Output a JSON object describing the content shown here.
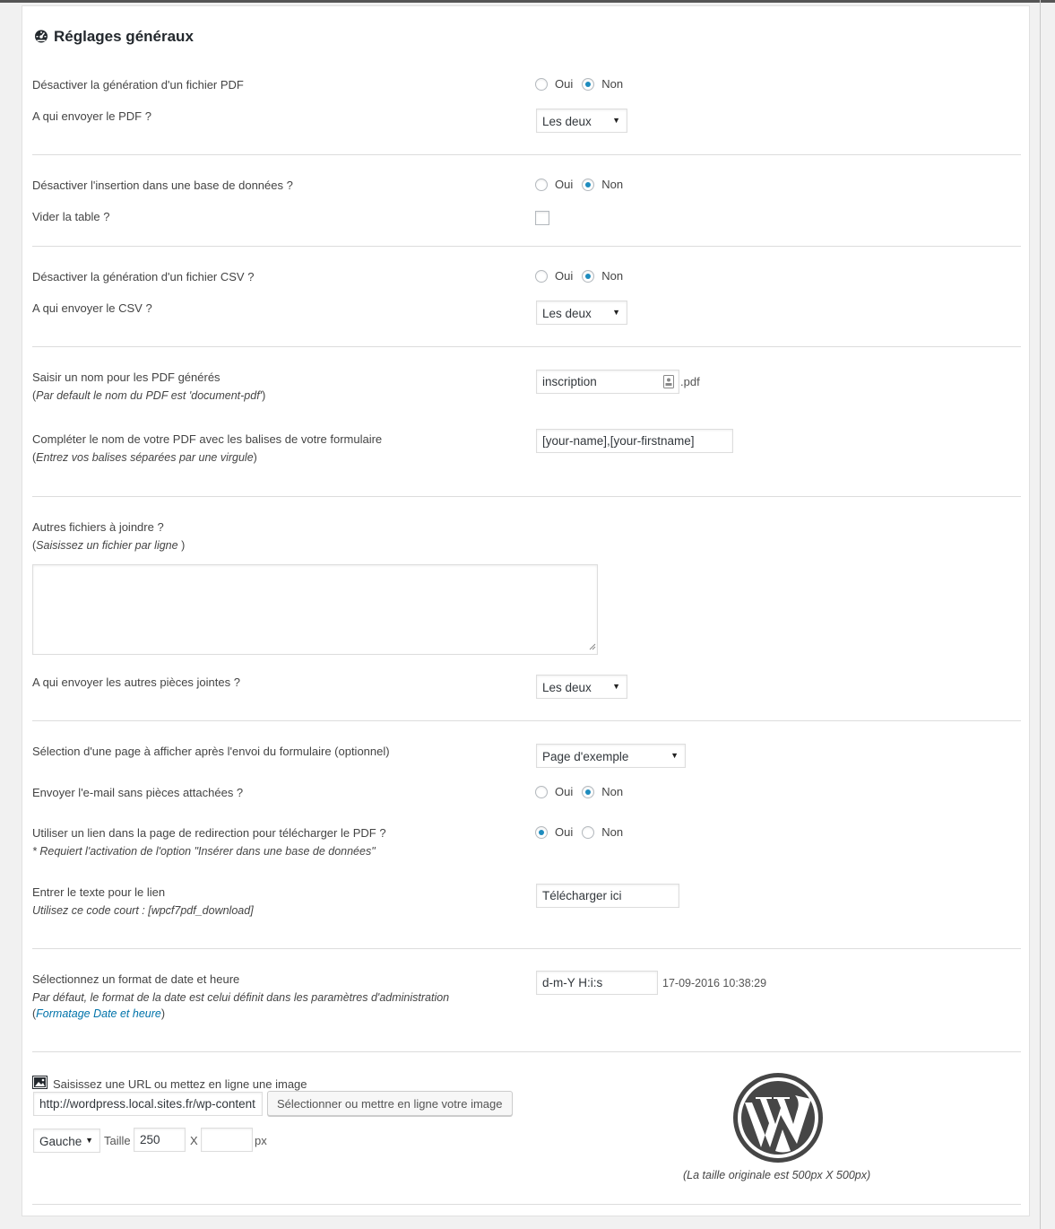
{
  "panel": {
    "title": "Réglages généraux",
    "icon": "dashboard-icon"
  },
  "pdf": {
    "disable_label": "Désactiver la génération d'un fichier PDF",
    "disable_selected": "Non",
    "send_label": "A qui envoyer le PDF ?",
    "send_value": "Les deux"
  },
  "radio": {
    "yes": "Oui",
    "no": "Non"
  },
  "db": {
    "disable_label": "Désactiver l'insertion dans une base de données ?",
    "disable_selected": "Non",
    "empty_label": "Vider la table ?",
    "empty_checked": false
  },
  "csv": {
    "disable_label": "Désactiver la génération d'un fichier CSV ?",
    "disable_selected": "Non",
    "send_label": "A qui envoyer le CSV ?",
    "send_value": "Les deux"
  },
  "pdfname": {
    "label": "Saisir un nom pour les PDF générés",
    "hint_open": "(",
    "hint_text": "Par default le nom du PDF est 'document-pdf'",
    "hint_close": ")",
    "value": "inscription",
    "suffix": ".pdf"
  },
  "tags": {
    "label": "Compléter le nom de votre PDF avec les balises de votre formulaire",
    "hint_open": "(",
    "hint_text": "Entrez vos balises séparées par une virgule",
    "hint_close": ")",
    "value": "[your-name],[your-firstname]"
  },
  "attachments": {
    "label": "Autres fichiers à joindre ?",
    "hint_open": "(",
    "hint_text": "Saisissez un fichier par ligne ",
    "hint_close": ")",
    "value": "",
    "send_label": "A qui envoyer les autres pièces jointes ?",
    "send_value": "Les deux"
  },
  "redirect": {
    "page_label": "Sélection d'une page à afficher après l'envoi du formulaire (optionnel)",
    "page_value": "Page d'exemple",
    "noattach_label": "Envoyer l'e-mail sans pièces attachées ?",
    "noattach_selected": "Non",
    "link_label": "Utiliser un lien dans la page de redirection pour télécharger le PDF ?",
    "link_note": "* Requiert l'activation de l'option \"Insérer dans une base de données\"",
    "link_selected": "Oui",
    "text_label": "Entrer le texte pour le lien",
    "text_hint": "Utilisez ce code court : [wpcf7pdf_download]",
    "text_value": "Télécharger ici"
  },
  "datetime": {
    "label": "Sélectionnez un format de date et heure",
    "hint": "Par défaut, le format de la date est celui définit dans les paramètres d'administration",
    "link_open": "(",
    "link_text": "Formatage Date et heure",
    "link_close": ")",
    "format_value": "d-m-Y H:i:s",
    "preview": "17-09-2016 10:38:29"
  },
  "image": {
    "label": "Saisissez une URL ou mettez en ligne une image",
    "url_value": "http://wordpress.local.sites.fr/wp-content",
    "upload_button": "Sélectionner ou mettre en ligne votre image",
    "align_value": "Gauche",
    "size_label": "Taille",
    "width_value": "250",
    "x_label": "X",
    "height_value": "",
    "px_label": "px",
    "caption": "(La taille originale est 500px X 500px)",
    "preview_logo": "wordpress-logo"
  },
  "colors": {
    "accent": "#1e8cbe",
    "link": "#0073aa",
    "logo": "#464646"
  }
}
